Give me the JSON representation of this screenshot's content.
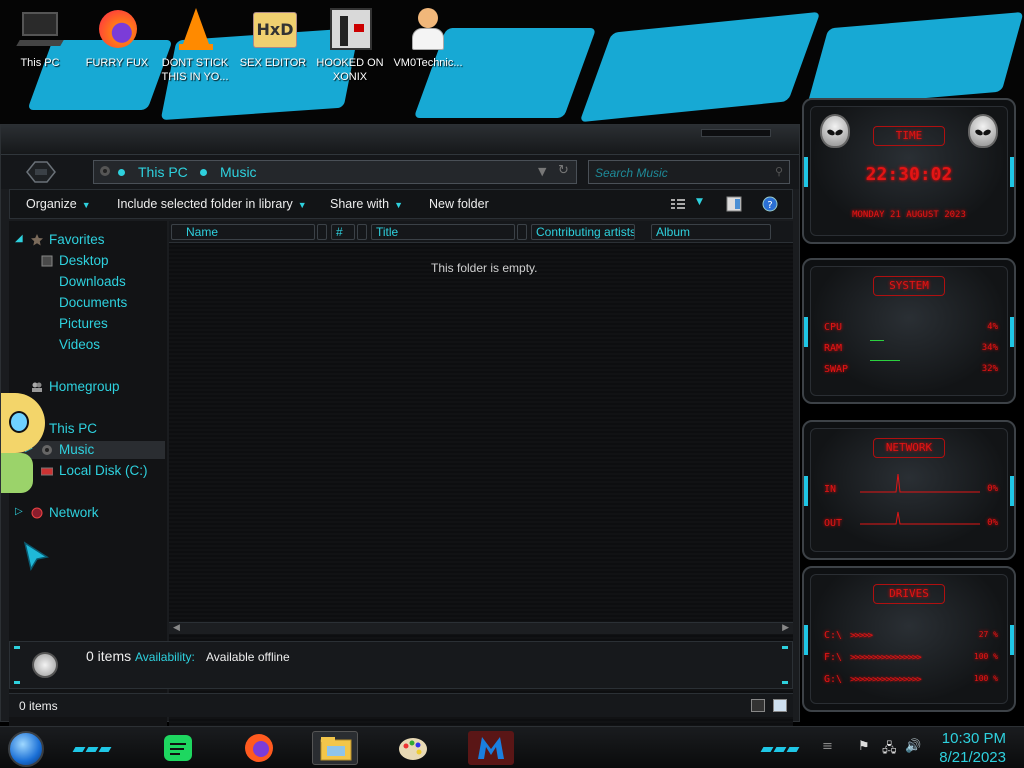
{
  "desktop": {
    "icons": [
      {
        "label": "This PC",
        "icon": "computer-icon"
      },
      {
        "label": "FURRY FUX",
        "icon": "firefox-icon"
      },
      {
        "label": "DONT STICK THIS IN YO...",
        "icon": "vlc-cone-icon"
      },
      {
        "label": "SEX EDITOR",
        "icon": "hxd-hex-editor-icon"
      },
      {
        "label": "HOOKED ON XONIX",
        "icon": "xonix-game-icon"
      },
      {
        "label": "VM0Technic...",
        "icon": "doctor-avatar-icon"
      }
    ]
  },
  "explorer": {
    "breadcrumb": [
      "This PC",
      "Music"
    ],
    "search_placeholder": "Search Music",
    "toolbar": {
      "organize": "Organize",
      "include": "Include selected folder in library",
      "share": "Share with",
      "new_folder": "New folder"
    },
    "nav": {
      "favorites": "Favorites",
      "desktop": "Desktop",
      "downloads": "Downloads",
      "documents": "Documents",
      "pictures": "Pictures",
      "videos": "Videos",
      "homegroup": "Homegroup",
      "this_pc": "This PC",
      "music": "Music",
      "local_disk": "Local Disk (C:)",
      "network": "Network"
    },
    "columns": [
      "Name",
      "#",
      "Title",
      "Contributing artists",
      "Album"
    ],
    "empty_message": "This folder is empty.",
    "details": {
      "count": "0 items",
      "availability_label": "Availability:",
      "availability_value": "Available offline"
    },
    "status": "0 items"
  },
  "gadgets": {
    "time": {
      "title": "TIME",
      "clock": "22:30:02",
      "date": "MONDAY 21 AUGUST 2023"
    },
    "system": {
      "title": "SYSTEM",
      "cpu_label": "CPU",
      "cpu": "4%",
      "ram_label": "RAM",
      "ram": "34%",
      "swap_label": "SWAP",
      "swap": "32%"
    },
    "network": {
      "title": "NETWORK",
      "in_label": "IN",
      "in": "0%",
      "out_label": "OUT",
      "out": "0%"
    },
    "drives": {
      "title": "DRIVES",
      "items": [
        {
          "label": "C:\\",
          "value": "27 %"
        },
        {
          "label": "F:\\",
          "value": "100 %"
        },
        {
          "label": "G:\\",
          "value": "100 %"
        }
      ]
    }
  },
  "taskbar": {
    "apps": [
      "spotify-icon",
      "firefox-icon",
      "file-explorer-icon",
      "paint-palette-icon",
      "malwarebytes-icon"
    ],
    "time": "10:30 PM",
    "date": "8/21/2023"
  },
  "colors": {
    "accent": "#2ed1de",
    "gadget_red": "#e21515",
    "wallpaper_blue": "#17a9d4"
  }
}
